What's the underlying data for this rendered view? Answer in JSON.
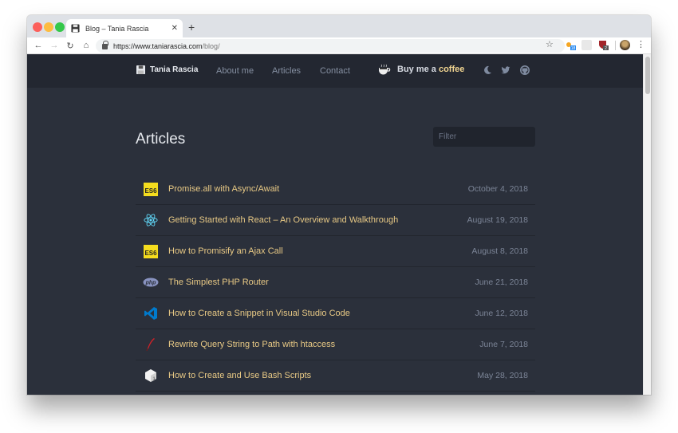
{
  "browser": {
    "tab_title": "Blog – Tania Rascia",
    "url_host": "https://www.taniarascia.com",
    "url_path": "/blog/",
    "extensions": [
      {
        "name": "rss-extension-icon",
        "badge": "18"
      },
      {
        "name": "blank-extension-icon",
        "badge": ""
      },
      {
        "name": "ublock-extension-icon",
        "badge": "2"
      }
    ]
  },
  "site": {
    "brand": "Tania Rascia",
    "nav": [
      "About me",
      "Articles",
      "Contact"
    ],
    "coffee_prefix": "Buy me a ",
    "coffee_word": "coffee",
    "icons": [
      "moon-icon",
      "twitter-icon",
      "github-icon"
    ]
  },
  "main": {
    "heading": "Articles",
    "filter_placeholder": "Filter",
    "articles": [
      {
        "icon": "es6",
        "title": "Promise.all with Async/Await",
        "date": "October 4, 2018"
      },
      {
        "icon": "react",
        "title": "Getting Started with React – An Overview and Walkthrough",
        "date": "August 19, 2018"
      },
      {
        "icon": "es6",
        "title": "How to Promisify an Ajax Call",
        "date": "August 8, 2018"
      },
      {
        "icon": "php",
        "title": "The Simplest PHP Router",
        "date": "June 21, 2018"
      },
      {
        "icon": "vscode",
        "title": "How to Create a Snippet in Visual Studio Code",
        "date": "June 12, 2018"
      },
      {
        "icon": "feather",
        "title": "Rewrite Query String to Path with htaccess",
        "date": "June 7, 2018"
      },
      {
        "icon": "bash",
        "title": "How to Create and Use Bash Scripts",
        "date": "May 28, 2018"
      }
    ],
    "es6_label": "ES6"
  }
}
